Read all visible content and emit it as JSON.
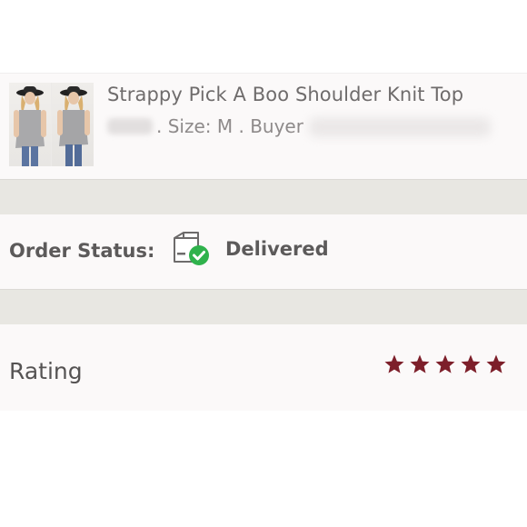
{
  "product": {
    "title": "Strappy Pick A Boo Shoulder Knit Top",
    "size_text": ". Size: M . Buyer",
    "image": "product-thumbnail"
  },
  "order": {
    "status_label": "Order Status:",
    "status_value": "Delivered",
    "status_icon": "delivered-box-check-icon",
    "check_color": "#2fb24c"
  },
  "rating": {
    "label": "Rating",
    "stars": 5,
    "max_stars": 5,
    "star_color": "#7d1f2a",
    "icon": "star-icon"
  }
}
